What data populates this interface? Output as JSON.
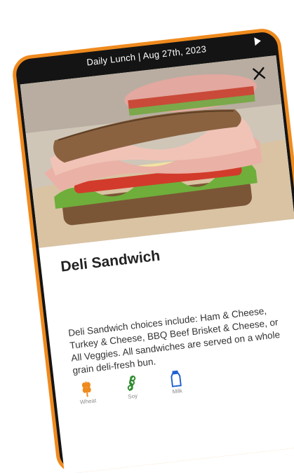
{
  "header": {
    "title": "Daily Lunch | Aug 27th, 2023"
  },
  "item": {
    "title": "Deli Sandwich",
    "description": "Deli Sandwich choices include: Ham & Cheese, Turkey & Cheese, BBQ Beef Brisket & Cheese, or All Veggies. All sandwiches are served on a whole grain deli-fresh bun."
  },
  "allergens": [
    {
      "label": "Wheat",
      "icon": "wheat-icon",
      "color": "#ef8a1e"
    },
    {
      "label": "Soy",
      "icon": "soy-icon",
      "color": "#2e8b2e"
    },
    {
      "label": "Milk",
      "icon": "milk-icon",
      "color": "#1e5fd1"
    }
  ],
  "colors": {
    "frame": "#ef8a1e",
    "phone": "#141414"
  }
}
